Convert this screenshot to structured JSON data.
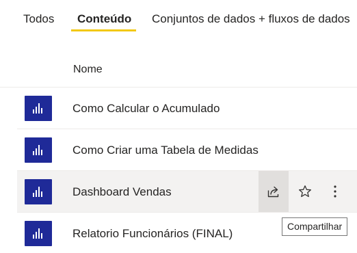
{
  "tabs": [
    {
      "label": "Todos",
      "active": false
    },
    {
      "label": "Conteúdo",
      "active": true
    },
    {
      "label": "Conjuntos de dados + fluxos de dados",
      "active": false
    }
  ],
  "accent_color": "#f2c811",
  "icon_color": "#1f2a98",
  "list": {
    "header": "Nome",
    "rows": [
      {
        "name": "Como Calcular o Acumulado",
        "icon": "report-bar-chart-icon"
      },
      {
        "name": "Como Criar uma Tabela de Medidas",
        "icon": "report-bar-chart-icon"
      },
      {
        "name": "Dashboard Vendas",
        "icon": "report-bar-chart-icon",
        "hovered": true
      },
      {
        "name": "Relatorio Funcionários (FINAL)",
        "icon": "report-bar-chart-icon"
      }
    ]
  },
  "row_actions": {
    "share_icon": "share-icon",
    "favorite_icon": "star-outline-icon",
    "more_icon": "more-vertical-icon"
  },
  "tooltip": {
    "text": "Compartilhar"
  }
}
